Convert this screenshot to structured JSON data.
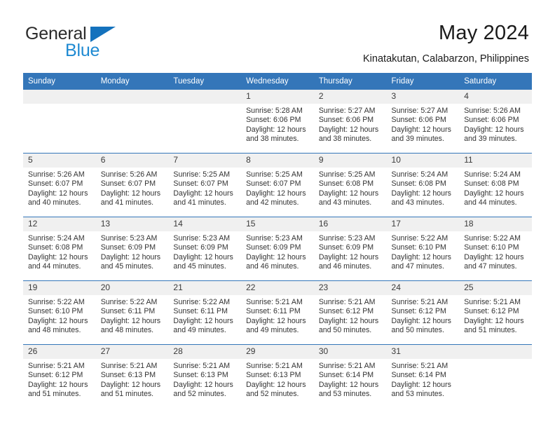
{
  "brand": {
    "name_part1": "General",
    "name_part2": "Blue",
    "logo_icon": "triangle-flag-icon",
    "accent_color": "#1f8ad2",
    "header_color": "#3476b9"
  },
  "header": {
    "title": "May 2024",
    "subtitle": "Kinatakutan, Calabarzon, Philippines"
  },
  "calendar": {
    "weekday_headers": [
      "Sunday",
      "Monday",
      "Tuesday",
      "Wednesday",
      "Thursday",
      "Friday",
      "Saturday"
    ],
    "weeks": [
      [
        {
          "day": "",
          "sunrise": "",
          "sunset": "",
          "daylight_line1": "",
          "daylight_line2": "",
          "empty": true
        },
        {
          "day": "",
          "sunrise": "",
          "sunset": "",
          "daylight_line1": "",
          "daylight_line2": "",
          "empty": true
        },
        {
          "day": "",
          "sunrise": "",
          "sunset": "",
          "daylight_line1": "",
          "daylight_line2": "",
          "empty": true
        },
        {
          "day": "1",
          "sunrise": "Sunrise: 5:28 AM",
          "sunset": "Sunset: 6:06 PM",
          "daylight_line1": "Daylight: 12 hours",
          "daylight_line2": "and 38 minutes.",
          "empty": false
        },
        {
          "day": "2",
          "sunrise": "Sunrise: 5:27 AM",
          "sunset": "Sunset: 6:06 PM",
          "daylight_line1": "Daylight: 12 hours",
          "daylight_line2": "and 38 minutes.",
          "empty": false
        },
        {
          "day": "3",
          "sunrise": "Sunrise: 5:27 AM",
          "sunset": "Sunset: 6:06 PM",
          "daylight_line1": "Daylight: 12 hours",
          "daylight_line2": "and 39 minutes.",
          "empty": false
        },
        {
          "day": "4",
          "sunrise": "Sunrise: 5:26 AM",
          "sunset": "Sunset: 6:06 PM",
          "daylight_line1": "Daylight: 12 hours",
          "daylight_line2": "and 39 minutes.",
          "empty": false
        }
      ],
      [
        {
          "day": "5",
          "sunrise": "Sunrise: 5:26 AM",
          "sunset": "Sunset: 6:07 PM",
          "daylight_line1": "Daylight: 12 hours",
          "daylight_line2": "and 40 minutes.",
          "empty": false
        },
        {
          "day": "6",
          "sunrise": "Sunrise: 5:26 AM",
          "sunset": "Sunset: 6:07 PM",
          "daylight_line1": "Daylight: 12 hours",
          "daylight_line2": "and 41 minutes.",
          "empty": false
        },
        {
          "day": "7",
          "sunrise": "Sunrise: 5:25 AM",
          "sunset": "Sunset: 6:07 PM",
          "daylight_line1": "Daylight: 12 hours",
          "daylight_line2": "and 41 minutes.",
          "empty": false
        },
        {
          "day": "8",
          "sunrise": "Sunrise: 5:25 AM",
          "sunset": "Sunset: 6:07 PM",
          "daylight_line1": "Daylight: 12 hours",
          "daylight_line2": "and 42 minutes.",
          "empty": false
        },
        {
          "day": "9",
          "sunrise": "Sunrise: 5:25 AM",
          "sunset": "Sunset: 6:08 PM",
          "daylight_line1": "Daylight: 12 hours",
          "daylight_line2": "and 43 minutes.",
          "empty": false
        },
        {
          "day": "10",
          "sunrise": "Sunrise: 5:24 AM",
          "sunset": "Sunset: 6:08 PM",
          "daylight_line1": "Daylight: 12 hours",
          "daylight_line2": "and 43 minutes.",
          "empty": false
        },
        {
          "day": "11",
          "sunrise": "Sunrise: 5:24 AM",
          "sunset": "Sunset: 6:08 PM",
          "daylight_line1": "Daylight: 12 hours",
          "daylight_line2": "and 44 minutes.",
          "empty": false
        }
      ],
      [
        {
          "day": "12",
          "sunrise": "Sunrise: 5:24 AM",
          "sunset": "Sunset: 6:08 PM",
          "daylight_line1": "Daylight: 12 hours",
          "daylight_line2": "and 44 minutes.",
          "empty": false
        },
        {
          "day": "13",
          "sunrise": "Sunrise: 5:23 AM",
          "sunset": "Sunset: 6:09 PM",
          "daylight_line1": "Daylight: 12 hours",
          "daylight_line2": "and 45 minutes.",
          "empty": false
        },
        {
          "day": "14",
          "sunrise": "Sunrise: 5:23 AM",
          "sunset": "Sunset: 6:09 PM",
          "daylight_line1": "Daylight: 12 hours",
          "daylight_line2": "and 45 minutes.",
          "empty": false
        },
        {
          "day": "15",
          "sunrise": "Sunrise: 5:23 AM",
          "sunset": "Sunset: 6:09 PM",
          "daylight_line1": "Daylight: 12 hours",
          "daylight_line2": "and 46 minutes.",
          "empty": false
        },
        {
          "day": "16",
          "sunrise": "Sunrise: 5:23 AM",
          "sunset": "Sunset: 6:09 PM",
          "daylight_line1": "Daylight: 12 hours",
          "daylight_line2": "and 46 minutes.",
          "empty": false
        },
        {
          "day": "17",
          "sunrise": "Sunrise: 5:22 AM",
          "sunset": "Sunset: 6:10 PM",
          "daylight_line1": "Daylight: 12 hours",
          "daylight_line2": "and 47 minutes.",
          "empty": false
        },
        {
          "day": "18",
          "sunrise": "Sunrise: 5:22 AM",
          "sunset": "Sunset: 6:10 PM",
          "daylight_line1": "Daylight: 12 hours",
          "daylight_line2": "and 47 minutes.",
          "empty": false
        }
      ],
      [
        {
          "day": "19",
          "sunrise": "Sunrise: 5:22 AM",
          "sunset": "Sunset: 6:10 PM",
          "daylight_line1": "Daylight: 12 hours",
          "daylight_line2": "and 48 minutes.",
          "empty": false
        },
        {
          "day": "20",
          "sunrise": "Sunrise: 5:22 AM",
          "sunset": "Sunset: 6:11 PM",
          "daylight_line1": "Daylight: 12 hours",
          "daylight_line2": "and 48 minutes.",
          "empty": false
        },
        {
          "day": "21",
          "sunrise": "Sunrise: 5:22 AM",
          "sunset": "Sunset: 6:11 PM",
          "daylight_line1": "Daylight: 12 hours",
          "daylight_line2": "and 49 minutes.",
          "empty": false
        },
        {
          "day": "22",
          "sunrise": "Sunrise: 5:21 AM",
          "sunset": "Sunset: 6:11 PM",
          "daylight_line1": "Daylight: 12 hours",
          "daylight_line2": "and 49 minutes.",
          "empty": false
        },
        {
          "day": "23",
          "sunrise": "Sunrise: 5:21 AM",
          "sunset": "Sunset: 6:12 PM",
          "daylight_line1": "Daylight: 12 hours",
          "daylight_line2": "and 50 minutes.",
          "empty": false
        },
        {
          "day": "24",
          "sunrise": "Sunrise: 5:21 AM",
          "sunset": "Sunset: 6:12 PM",
          "daylight_line1": "Daylight: 12 hours",
          "daylight_line2": "and 50 minutes.",
          "empty": false
        },
        {
          "day": "25",
          "sunrise": "Sunrise: 5:21 AM",
          "sunset": "Sunset: 6:12 PM",
          "daylight_line1": "Daylight: 12 hours",
          "daylight_line2": "and 51 minutes.",
          "empty": false
        }
      ],
      [
        {
          "day": "26",
          "sunrise": "Sunrise: 5:21 AM",
          "sunset": "Sunset: 6:12 PM",
          "daylight_line1": "Daylight: 12 hours",
          "daylight_line2": "and 51 minutes.",
          "empty": false
        },
        {
          "day": "27",
          "sunrise": "Sunrise: 5:21 AM",
          "sunset": "Sunset: 6:13 PM",
          "daylight_line1": "Daylight: 12 hours",
          "daylight_line2": "and 51 minutes.",
          "empty": false
        },
        {
          "day": "28",
          "sunrise": "Sunrise: 5:21 AM",
          "sunset": "Sunset: 6:13 PM",
          "daylight_line1": "Daylight: 12 hours",
          "daylight_line2": "and 52 minutes.",
          "empty": false
        },
        {
          "day": "29",
          "sunrise": "Sunrise: 5:21 AM",
          "sunset": "Sunset: 6:13 PM",
          "daylight_line1": "Daylight: 12 hours",
          "daylight_line2": "and 52 minutes.",
          "empty": false
        },
        {
          "day": "30",
          "sunrise": "Sunrise: 5:21 AM",
          "sunset": "Sunset: 6:14 PM",
          "daylight_line1": "Daylight: 12 hours",
          "daylight_line2": "and 53 minutes.",
          "empty": false
        },
        {
          "day": "31",
          "sunrise": "Sunrise: 5:21 AM",
          "sunset": "Sunset: 6:14 PM",
          "daylight_line1": "Daylight: 12 hours",
          "daylight_line2": "and 53 minutes.",
          "empty": false
        },
        {
          "day": "",
          "sunrise": "",
          "sunset": "",
          "daylight_line1": "",
          "daylight_line2": "",
          "empty": true
        }
      ]
    ]
  }
}
